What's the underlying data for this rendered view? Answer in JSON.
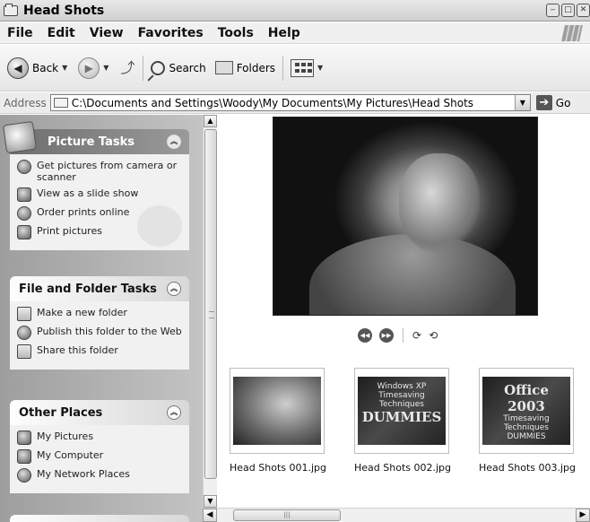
{
  "window": {
    "title": "Head Shots"
  },
  "menu": [
    "File",
    "Edit",
    "View",
    "Favorites",
    "Tools",
    "Help"
  ],
  "toolbar": {
    "back_label": "Back",
    "search_label": "Search",
    "folders_label": "Folders"
  },
  "address": {
    "label": "Address",
    "path": "C:\\Documents and Settings\\Woody\\My Documents\\My Pictures\\Head Shots",
    "go_label": "Go"
  },
  "left_pane": {
    "picture_tasks": {
      "title": "Picture Tasks",
      "items": [
        "Get pictures from camera or scanner",
        "View as a slide show",
        "Order prints online",
        "Print pictures"
      ]
    },
    "file_folder_tasks": {
      "title": "File and Folder Tasks",
      "items": [
        "Make a new folder",
        "Publish this folder to the Web",
        "Share this folder"
      ]
    },
    "other_places": {
      "title": "Other Places",
      "items": [
        "My Pictures",
        "My Computer",
        "My Network Places"
      ]
    }
  },
  "thumbnails": [
    {
      "name": "Head Shots 001.jpg"
    },
    {
      "name": "Head Shots 002.jpg",
      "book_line1": "Windows XP",
      "book_line2": "Timesaving Techniques",
      "book_line3": "DUMMIES"
    },
    {
      "name": "Head Shots 003.jpg",
      "book_line1": "Office 2003",
      "book_line2": "Timesaving Techniques",
      "book_line3": "DUMMIES"
    }
  ]
}
